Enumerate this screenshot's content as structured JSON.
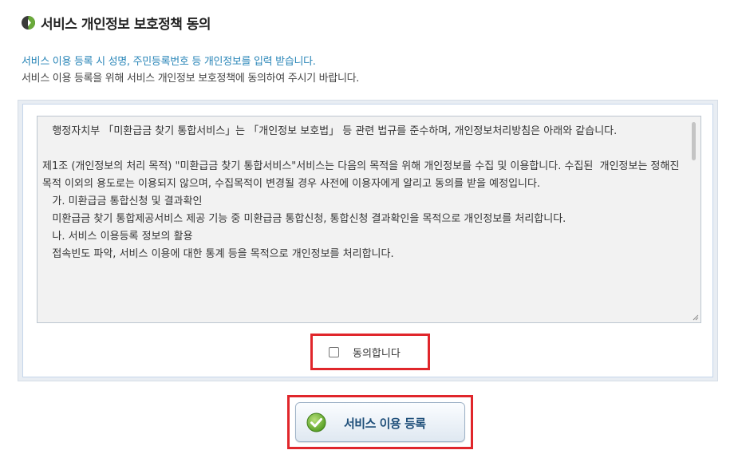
{
  "header": {
    "title": "서비스 개인정보 보호정책 동의",
    "icon": "leaf-bullet-icon"
  },
  "descriptions": {
    "line1": "서비스 이용 등록 시 성명, 주민등록번호 등 개인정보를 입력 받습니다.",
    "line2": "서비스 이용 등록을 위해 서비스 개인정보 보호정책에 동의하여 주시기 바랍니다."
  },
  "terms": {
    "lines": [
      "   행정자치부 「미환급금 찾기 통합서비스」는 「개인정보 보호법」 등 관련 법규를 준수하며, 개인정보처리방침은 아래와 같습니다.",
      "",
      "제1조 (개인정보의 처리 목적) \"미환급금 찾기 통합서비스\"서비스는 다음의 목적을 위해 개인정보를 수집 및 이용합니다. 수집된  개인정보는 정해진 목적 이외의 용도로는 이용되지 않으며, 수집목적이 변경될 경우 사전에 이용자에게 알리고 동의를 받을 예정입니다.",
      "   가. 미환급금 통합신청 및 결과확인",
      "   미환급금 찾기 통합제공서비스 제공 기능 중 미환급금 통합신청, 통합신청 결과확인을 목적으로 개인정보를 처리합니다.",
      "   나. 서비스 이용등록 정보의 활용",
      "   접속빈도 파악, 서비스 이용에 대한 통계 등을 목적으로 개인정보를 처리합니다."
    ]
  },
  "agree": {
    "label": "동의합니다",
    "checked": false
  },
  "submit": {
    "label": "서비스 이용 등록",
    "icon": "green-check-icon"
  },
  "colors": {
    "highlight": "#e0262b",
    "info_text": "#2a86b8",
    "button_text": "#1f4f7a"
  }
}
